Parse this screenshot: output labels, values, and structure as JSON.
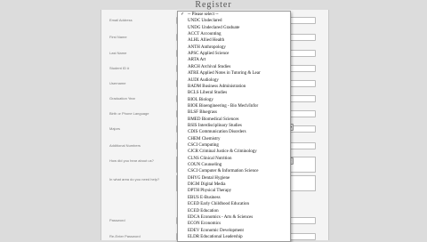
{
  "page": {
    "title": "Register"
  },
  "form": {
    "fields": [
      {
        "label": "Email Address"
      },
      {
        "label": "First Name"
      },
      {
        "label": "Last Name"
      },
      {
        "label": "Student ID #"
      },
      {
        "label": "Username"
      },
      {
        "label": "Graduation Year"
      },
      {
        "label": "Birth or Phone Language"
      },
      {
        "label": "Majors"
      },
      {
        "label": "Additional Numbers"
      },
      {
        "label": "How did you hear about us?"
      },
      {
        "label": "In what area do you need help?"
      },
      {
        "label": "Password"
      },
      {
        "label": "Re-Enter Password"
      }
    ]
  },
  "majors_dropdown": {
    "selected": "-- Please select --",
    "options": [
      "-- Please select --",
      "UNDC Undeclared",
      "UNDG Undeclared Graduate",
      "ACCT Accounting",
      "ALHL Allied Health",
      "ANTH Anthropology",
      "APSC Applied Science",
      "ARTA Art",
      "ARCH Archival Studies",
      "ATRE Applied Notes in Tutoring & Lear",
      "AUDI Audiology",
      "BADM Business Administration",
      "BCLS Liberal Studies",
      "BIOL Biology",
      "BIOE Bioengineering - Bio Mech/Infor",
      "BLSF Bluegrass",
      "BMED Biomedical Sciences",
      "BSIS Interdisciplinary Studies",
      "CDIS Communication Disorders",
      "CHEM Chemistry",
      "CSCI Computing",
      "CJCR Criminal Justice & Criminology",
      "CLNS Clinical Nutrition",
      "COUN Counseling",
      "CSCI Computer & Information Science",
      "DHYG Dental Hygiene",
      "DIGM Digital Media",
      "DPTH Physical Therapy",
      "EBUS E-Business",
      "ECED Early Childhood Education",
      "ECED Education",
      "EDCA Economics - Arts & Sciences",
      "ECON Economics",
      "EDEV Economic Development",
      "ELDR Educational Leadership"
    ]
  }
}
